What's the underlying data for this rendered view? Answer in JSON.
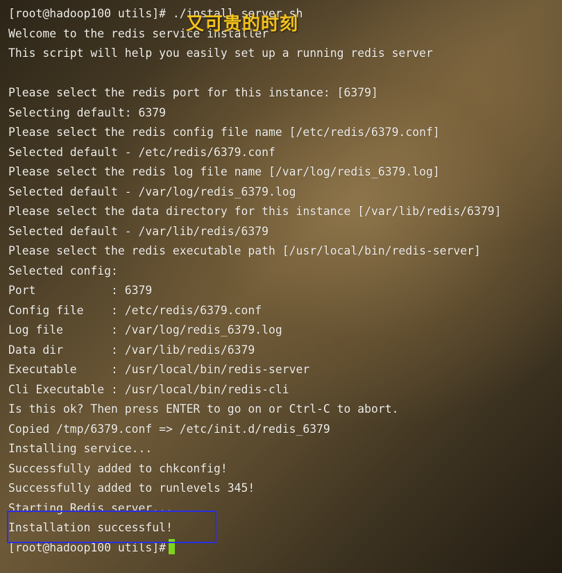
{
  "terminal": {
    "lines": [
      "[root@hadoop100 utils]# ./install_server.sh",
      "Welcome to the redis service installer",
      "This script will help you easily set up a running redis server",
      "",
      "Please select the redis port for this instance: [6379]",
      "Selecting default: 6379",
      "Please select the redis config file name [/etc/redis/6379.conf]",
      "Selected default - /etc/redis/6379.conf",
      "Please select the redis log file name [/var/log/redis_6379.log]",
      "Selected default - /var/log/redis_6379.log",
      "Please select the data directory for this instance [/var/lib/redis/6379]",
      "Selected default - /var/lib/redis/6379",
      "Please select the redis executable path [/usr/local/bin/redis-server]",
      "Selected config:",
      "Port           : 6379",
      "Config file    : /etc/redis/6379.conf",
      "Log file       : /var/log/redis_6379.log",
      "Data dir       : /var/lib/redis/6379",
      "Executable     : /usr/local/bin/redis-server",
      "Cli Executable : /usr/local/bin/redis-cli",
      "Is this ok? Then press ENTER to go on or Ctrl-C to abort.",
      "Copied /tmp/6379.conf => /etc/init.d/redis_6379",
      "Installing service...",
      "Successfully added to chkconfig!",
      "Successfully added to runlevels 345!",
      "Starting Redis server...",
      "Installation successful!"
    ],
    "prompt": "[root@hadoop100 utils]#"
  },
  "watermark": "又可贵的时刻",
  "colors": {
    "text": "#f2f0ea",
    "cursor": "#7ed321",
    "highlight_box": "#2a2ee8",
    "watermark": "#f4c21a"
  }
}
